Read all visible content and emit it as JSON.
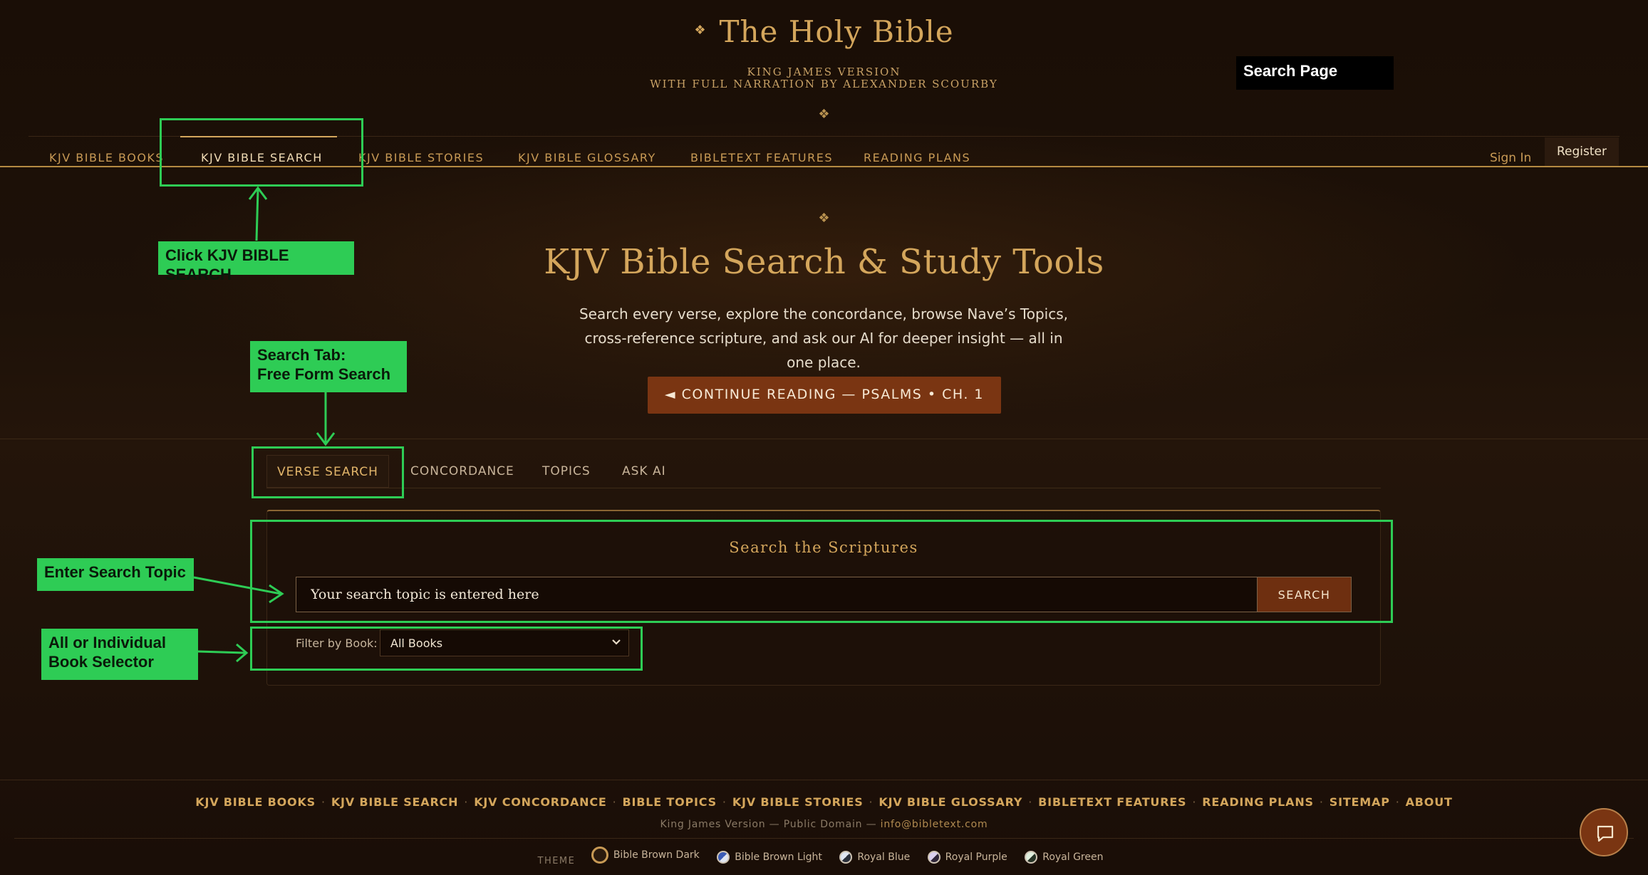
{
  "header": {
    "title": "The Holy Bible",
    "subtitle_1": "KING JAMES VERSION",
    "subtitle_2": "WITH FULL NARRATION BY ALEXANDER SCOURBY",
    "ornament": "❖"
  },
  "page_label": "Search Page",
  "nav": {
    "items": [
      {
        "label": "KJV BIBLE BOOKS"
      },
      {
        "label": "KJV BIBLE SEARCH"
      },
      {
        "label": "KJV BIBLE STORIES"
      },
      {
        "label": "KJV BIBLE GLOSSARY"
      },
      {
        "label": "BIBLETEXT FEATURES"
      },
      {
        "label": "READING PLANS"
      }
    ],
    "active": "KJV BIBLE SEARCH",
    "sign_in": "Sign In",
    "register": "Register"
  },
  "hero": {
    "title": "KJV Bible Search & Study Tools",
    "description": "Search every verse, explore the concordance, browse Nave’s Topics, cross-reference scripture, and ask our AI for deeper insight — all in one place.",
    "continue_button": "◄ CONTINUE READING — PSALMS • CH. 1"
  },
  "tabs": {
    "items": [
      "VERSE SEARCH",
      "CONCORDANCE",
      "TOPICS",
      "ASK AI"
    ],
    "active": "VERSE SEARCH"
  },
  "search_panel": {
    "title": "Search the Scriptures",
    "input_value": "Your search topic is entered here",
    "search_button": "SEARCH",
    "filter_label": "Filter by Book:",
    "book_selected": "All Books"
  },
  "annotations": {
    "click_search": "Click KJV BIBLE SEARCH",
    "search_tab_line1": "Search Tab:",
    "search_tab_line2": "Free Form Search",
    "enter_topic": "Enter Search Topic",
    "book_selector_line1": "All or Individual",
    "book_selector_line2": "Book Selector",
    "color": "#2ecc55"
  },
  "footer": {
    "links": [
      "KJV BIBLE BOOKS",
      "KJV BIBLE SEARCH",
      "KJV CONCORDANCE",
      "BIBLE TOPICS",
      "KJV BIBLE STORIES",
      "KJV BIBLE GLOSSARY",
      "BIBLETEXT FEATURES",
      "READING PLANS",
      "SITEMAP",
      "ABOUT"
    ],
    "separator": "·",
    "copyright": "King James Version — Public Domain —",
    "email": "info@bibletext.com",
    "theme_label": "THEME",
    "themes": [
      {
        "name": "Bible Brown Dark",
        "color": "#2a1a0e"
      },
      {
        "name": "Bible Brown Light",
        "color": "#3b5bb5"
      },
      {
        "name": "Royal Blue",
        "color": "#e0e6f2"
      },
      {
        "name": "Royal Purple",
        "color": "#d9cfee"
      },
      {
        "name": "Royal Green",
        "color": "#dfeedd"
      }
    ]
  },
  "chat_icon": "chat-bubble-icon",
  "colors": {
    "accent_gold": "#d4a65c",
    "button_brown": "#7a3512",
    "background": "#1b0f07"
  }
}
